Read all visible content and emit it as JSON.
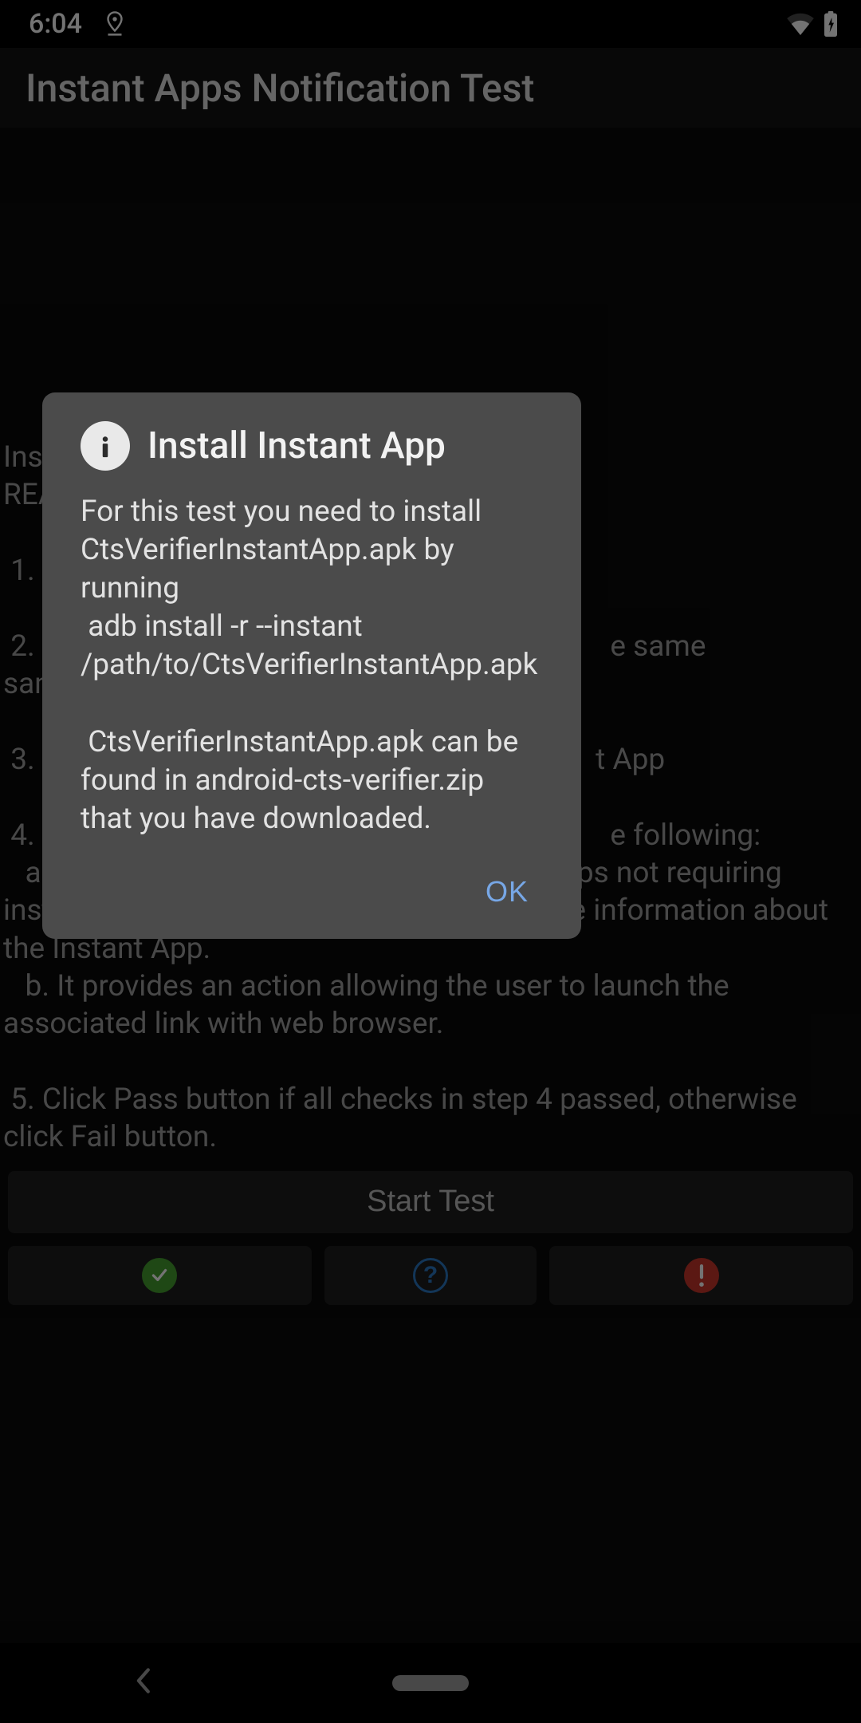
{
  "status_bar": {
    "time": "6:04",
    "icons": {
      "location": "location-icon",
      "wifi": "wifi-icon",
      "battery": "battery-charging-icon"
    }
  },
  "app_bar": {
    "title": "Instant Apps Notification Test"
  },
  "content": {
    "instructions": "Instant Apps Notification Test.\nREA\n\n 1. C\n\n 2. A                                                                           e same\nsame\n\n 3. D                                                                         t App\n\n 4. C                                                                           e following:\n   a. It provides information about Instant Apps not requiring installation and an action that provides more information about the Instant App.\n   b. It provides an action allowing the user to launch the associated link with web browser.\n\n 5. Click Pass button if all checks in step 4 passed, otherwise click Fail button.",
    "start_button": "Start Test",
    "buttons": {
      "pass_icon": "check-circle-icon",
      "help_icon": "help-circle-icon",
      "fail_icon": "alert-circle-icon"
    }
  },
  "dialog": {
    "icon": "info-icon",
    "title": "Install Instant App",
    "body": "For this test you need to install CtsVerifierInstantApp.apk by running\n adb install -r --instant /path/to/CtsVerifierInstantApp.apk\n\n CtsVerifierInstantApp.apk can be found in android-cts-verifier.zip that you have downloaded.",
    "ok_label": "OK"
  },
  "colors": {
    "pass": "#4caf50",
    "help": "#2196f3",
    "fail": "#f44336",
    "dialog_accent": "#77a7e6"
  }
}
